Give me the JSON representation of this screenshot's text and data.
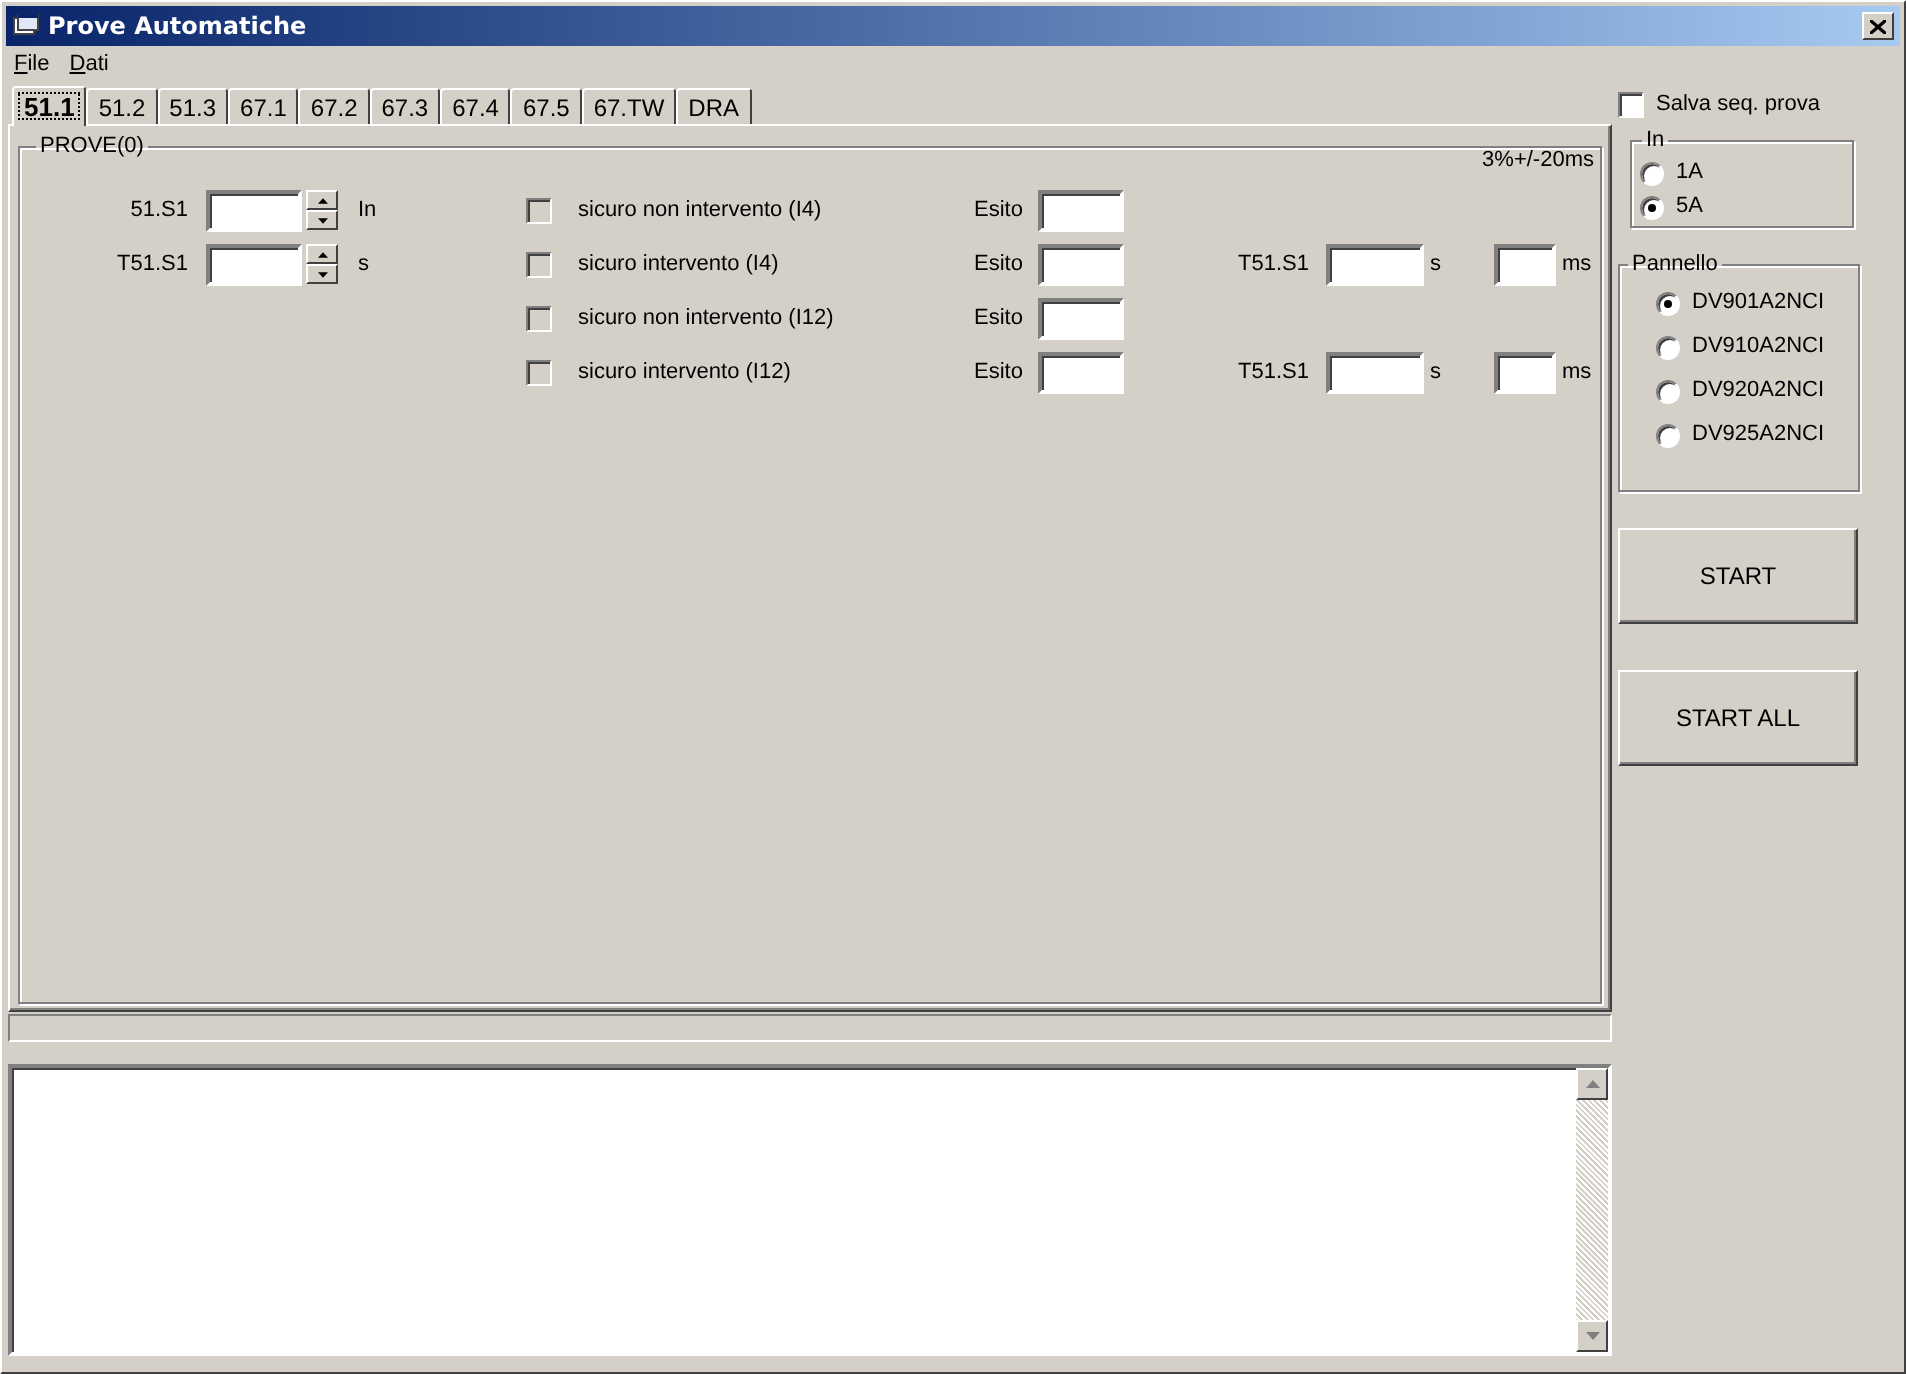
{
  "window": {
    "title": "Prove Automatiche"
  },
  "menu": [
    "File",
    "Dati"
  ],
  "tabs": [
    {
      "label": "51.1",
      "selected": true
    },
    {
      "label": "51.2",
      "selected": false
    },
    {
      "label": "51.3",
      "selected": false
    },
    {
      "label": "67.1",
      "selected": false
    },
    {
      "label": "67.2",
      "selected": false
    },
    {
      "label": "67.3",
      "selected": false
    },
    {
      "label": "67.4",
      "selected": false
    },
    {
      "label": "67.5",
      "selected": false
    },
    {
      "label": "67.TW",
      "selected": false
    },
    {
      "label": "DRA",
      "selected": false
    }
  ],
  "group": {
    "title": "PROVE(0)",
    "tolerance": "3%+/-20ms",
    "settings": [
      {
        "label": "51.S1",
        "unit": "In"
      },
      {
        "label": "T51.S1",
        "unit": "s"
      }
    ],
    "tests": [
      {
        "label": "sicuro non intervento (I4)",
        "checked": false,
        "disabled": true,
        "result_label": "Esito"
      },
      {
        "label": "sicuro intervento (I4)",
        "checked": false,
        "disabled": true,
        "result_label": "Esito",
        "time": {
          "label": "T51.S1",
          "unit": "s",
          "ms_unit": "ms"
        }
      },
      {
        "label": "sicuro non intervento (I12)",
        "checked": false,
        "disabled": true,
        "result_label": "Esito"
      },
      {
        "label": "sicuro intervento (I12)",
        "checked": false,
        "disabled": true,
        "result_label": "Esito",
        "time": {
          "label": "T51.S1",
          "unit": "s",
          "ms_unit": "ms"
        }
      }
    ]
  },
  "save_sequence": {
    "label": "Salva seq. prova",
    "checked": false
  },
  "in_group": {
    "title": "In",
    "options": [
      {
        "label": "1A",
        "selected": false
      },
      {
        "label": "5A",
        "selected": true
      }
    ]
  },
  "panel_group": {
    "title": "Pannello",
    "options": [
      {
        "label": "DV901A2NCI",
        "selected": true
      },
      {
        "label": "DV910A2NCI",
        "selected": false
      },
      {
        "label": "DV920A2NCI",
        "selected": false
      },
      {
        "label": "DV925A2NCI",
        "selected": false
      }
    ]
  },
  "buttons": [
    "START",
    "START ALL"
  ],
  "progress": {
    "level": 0
  }
}
